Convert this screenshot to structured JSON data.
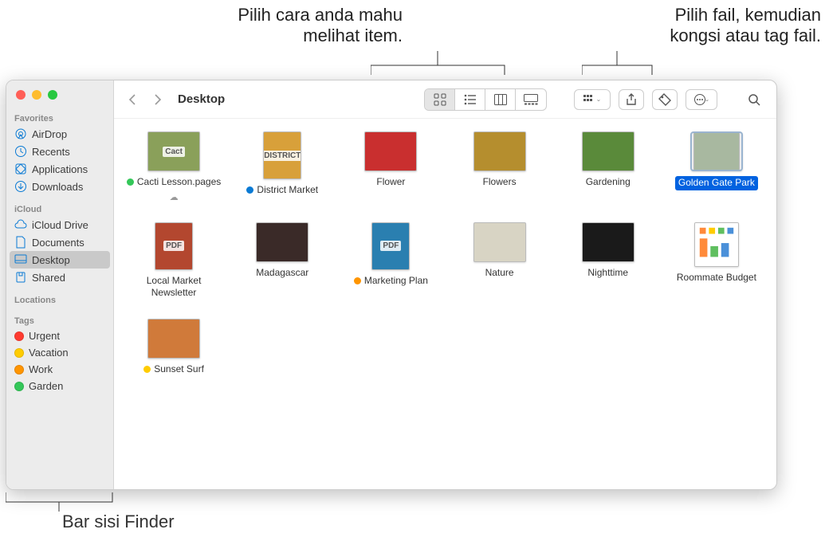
{
  "annotations": {
    "view": "Pilih cara anda mahu\nmelihat item.",
    "share": "Pilih fail, kemudian\nkongsi atau tag fail.",
    "sidebar": "Bar sisi Finder"
  },
  "window": {
    "title": "Desktop",
    "sidebar": {
      "sections": [
        {
          "title": "Favorites",
          "items": [
            {
              "label": "AirDrop",
              "icon": "airdrop"
            },
            {
              "label": "Recents",
              "icon": "clock"
            },
            {
              "label": "Applications",
              "icon": "app"
            },
            {
              "label": "Downloads",
              "icon": "download"
            }
          ]
        },
        {
          "title": "iCloud",
          "items": [
            {
              "label": "iCloud Drive",
              "icon": "cloud"
            },
            {
              "label": "Documents",
              "icon": "doc"
            },
            {
              "label": "Desktop",
              "icon": "desktop",
              "selected": true
            },
            {
              "label": "Shared",
              "icon": "shared"
            }
          ]
        },
        {
          "title": "Locations",
          "items": []
        },
        {
          "title": "Tags",
          "items": [
            {
              "label": "Urgent",
              "tag": "#ff3b30"
            },
            {
              "label": "Vacation",
              "tag": "#ffcc00"
            },
            {
              "label": "Work",
              "tag": "#ff9500"
            },
            {
              "label": "Garden",
              "tag": "#34c759"
            }
          ]
        }
      ]
    }
  },
  "files": [
    {
      "name": "Cacti Lesson.pages",
      "tag": "#34c759",
      "cloud": true,
      "thumbText": "Cact",
      "thumbBg": "#8aa05a"
    },
    {
      "name": "District Market",
      "tag": "#0a7ad4",
      "thumbText": "DISTRICT",
      "thumbBg": "#d8a03a",
      "doc": true
    },
    {
      "name": "Flower",
      "thumbBg": "#c92f2f"
    },
    {
      "name": "Flowers",
      "thumbBg": "#b58e2e"
    },
    {
      "name": "Gardening",
      "thumbBg": "#5a8a3a"
    },
    {
      "name": "Golden Gate Park",
      "thumbBg": "#a8b8a0",
      "selected": true
    },
    {
      "name": "Local Market Newsletter",
      "thumbText": "PDF",
      "thumbBg": "#b3472f",
      "doc": true
    },
    {
      "name": "Madagascar",
      "thumbBg": "#3a2a28"
    },
    {
      "name": "Marketing Plan",
      "tag": "#ff9500",
      "thumbText": "PDF",
      "thumbBg": "#2a7fb0",
      "doc": true
    },
    {
      "name": "Nature",
      "thumbBg": "#d8d4c4"
    },
    {
      "name": "Nighttime",
      "thumbBg": "#1a1a1a"
    },
    {
      "name": "Roommate Budget",
      "thumbBg": "#ffffff",
      "sheet": true
    },
    {
      "name": "Sunset Surf",
      "tag": "#ffcc00",
      "thumbBg": "#d07a3a"
    }
  ]
}
